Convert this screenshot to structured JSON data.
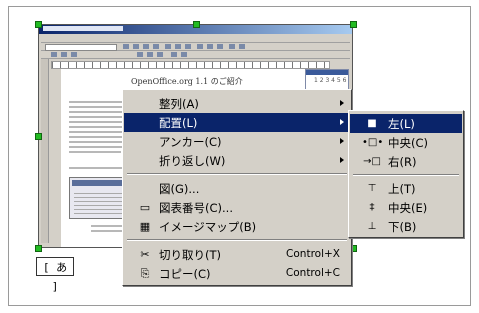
{
  "ime_indicator": "[ あ ]",
  "document": {
    "page_title": "OpenOffice.org 1.1 のご紹介",
    "navigator_label": "1 2 3 4 5 6"
  },
  "context_menu": {
    "items": [
      {
        "label": "整列(A)",
        "icon": "",
        "accel": "",
        "submenu": true
      },
      {
        "label": "配置(L)",
        "icon": "",
        "accel": "",
        "submenu": true,
        "highlighted": true
      },
      {
        "label": "アンカー(C)",
        "icon": "",
        "accel": "",
        "submenu": true
      },
      {
        "label": "折り返し(W)",
        "icon": "",
        "accel": "",
        "submenu": true
      },
      {
        "label": "図(G)...",
        "icon": "",
        "accel": "",
        "submenu": false
      },
      {
        "label": "図表番号(C)...",
        "icon": "caption-icon",
        "accel": "",
        "submenu": false
      },
      {
        "label": "イメージマップ(B)",
        "icon": "imagemap-icon",
        "accel": "",
        "submenu": false
      },
      {
        "label": "切り取り(T)",
        "icon": "scissors-icon",
        "accel": "Control+X",
        "submenu": false
      },
      {
        "label": "コピー(C)",
        "icon": "copy-icon",
        "accel": "Control+C",
        "submenu": false
      }
    ],
    "icon_glyphs": {
      "caption-icon": "▭",
      "imagemap-icon": "▦",
      "scissors-icon": "✂",
      "copy-icon": "⎘"
    }
  },
  "align_submenu": {
    "items": [
      {
        "label": "左(L)",
        "icon": "align-left-icon",
        "glyph": "■",
        "highlighted": true
      },
      {
        "label": "中央(C)",
        "icon": "align-center-icon",
        "glyph": "•□•"
      },
      {
        "label": "右(R)",
        "icon": "align-right-icon",
        "glyph": "→□"
      },
      {
        "label": "上(T)",
        "icon": "align-top-icon",
        "glyph": "⊤"
      },
      {
        "label": "中央(E)",
        "icon": "align-middle-icon",
        "glyph": "‡"
      },
      {
        "label": "下(B)",
        "icon": "align-bottom-icon",
        "glyph": "⊥"
      }
    ]
  },
  "colors": {
    "highlight": "#0a246a",
    "menu_bg": "#d4d0c8",
    "handle": "#22bb22"
  }
}
